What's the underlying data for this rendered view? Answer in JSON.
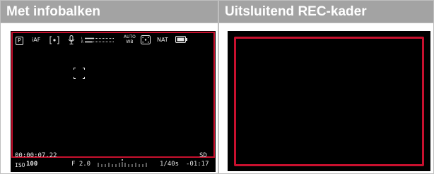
{
  "columns": [
    {
      "title": "Met infobalken"
    },
    {
      "title": "Uitsluitend REC-kader"
    }
  ],
  "top_bar": {
    "mode": "P",
    "af": "iAF",
    "wb_top": "AUTO",
    "wb_bottom": "WB",
    "film_style": "NAT"
  },
  "bottom_bar": {
    "timecode": "00:00:07.22",
    "iso_label": "ISO",
    "iso_value": "100",
    "aperture": "F 2.0",
    "shutter": "1/40s",
    "card": "SD",
    "remaining": "-01:17"
  },
  "colors": {
    "header_bg": "#a3a3a3",
    "rec_frame": "#c8102e",
    "screen_bg": "#000000"
  }
}
